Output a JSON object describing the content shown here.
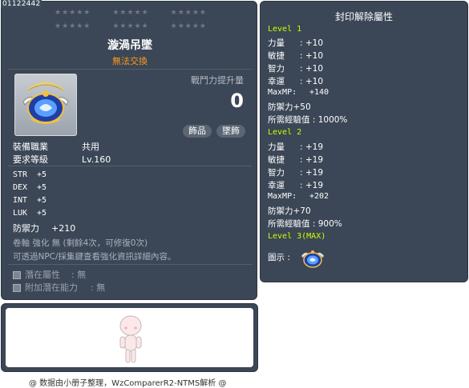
{
  "item_id": "01122442",
  "tooltip": {
    "stars_row1": [
      "★★★★★",
      "★★★★★",
      "★★★★★"
    ],
    "stars_row2": [
      "★★★★★",
      "★★★★★",
      "★★★★★"
    ],
    "name": "漩渦吊墜",
    "trade_note": "無法交換",
    "power_label": "戰鬥力提升量",
    "power_value": "0",
    "tags": [
      "飾品",
      "墜飾"
    ],
    "job_label": "裝備職業",
    "job_value": "共用",
    "level_label": "要求等級",
    "level_value": "Lv.160",
    "stats": [
      {
        "key": "STR",
        "value": "+5"
      },
      {
        "key": "DEX",
        "value": "+5"
      },
      {
        "key": "INT",
        "value": "+5"
      },
      {
        "key": "LUK",
        "value": "+5"
      }
    ],
    "defense_label": "防禦力",
    "defense_value": "+210",
    "scroll_note": "卷軸 強化 無 (剩餘4次，可修復0次)",
    "npc_note": "可透過NPC/採集鍵查看強化資訊詳細內容。",
    "potential_label": "潛在屬性",
    "potential_value": ": 無",
    "bonus_potential_label": "附加潛在能力",
    "bonus_potential_value": ": 無"
  },
  "credit": "@ 数据由小册子整理，WzComparerR2-NTMS解析 @",
  "seal": {
    "title": "封印解除屬性",
    "level1_title": "Level 1",
    "level1_stats": [
      {
        "key": "力量",
        "value": ": +10"
      },
      {
        "key": "敏捷",
        "value": ": +10"
      },
      {
        "key": "智力",
        "value": ": +10"
      },
      {
        "key": "幸運",
        "value": ": +10"
      }
    ],
    "level1_mp_label": "MaxMP:",
    "level1_mp_value": "+140",
    "level1_def": "防禦力+50",
    "level1_exp": "所需經驗值 : 1000%",
    "level2_title": "Level 2",
    "level2_stats": [
      {
        "key": "力量",
        "value": ": +19"
      },
      {
        "key": "敏捷",
        "value": ": +19"
      },
      {
        "key": "智力",
        "value": ": +19"
      },
      {
        "key": "幸運",
        "value": ": +19"
      }
    ],
    "level2_mp_label": "MaxMP:",
    "level2_mp_value": "+202",
    "level2_def": "防禦力+70",
    "level2_exp": "所需經驗值 : 900%",
    "level3_title": "Level 3(MAX)",
    "illustration_label": "圖示 :"
  },
  "colors": {
    "panel_bg": "#3b4656",
    "trade_note": "#ff9a1c",
    "level_title": "#ccff00"
  },
  "icons": [
    "pendant-icon",
    "character-preview-icon",
    "potential-box-icon"
  ]
}
